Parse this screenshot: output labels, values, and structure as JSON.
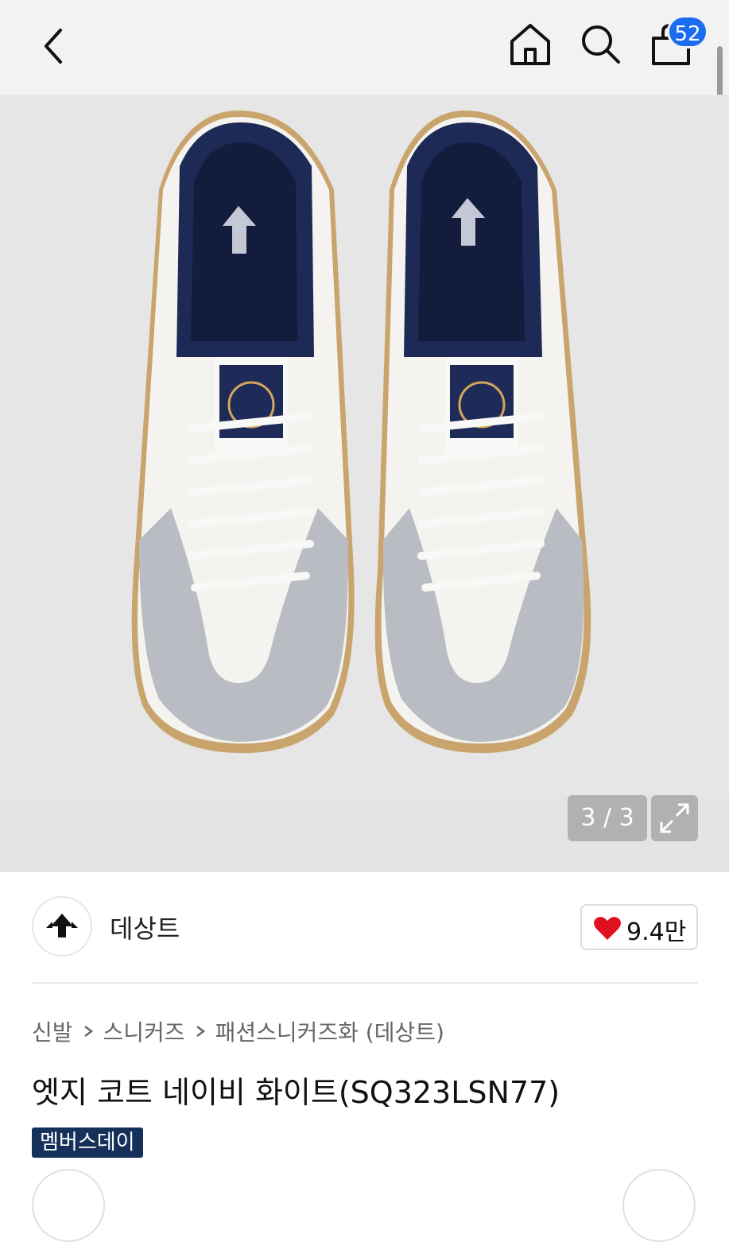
{
  "header": {
    "back_icon": "chevron-left-icon",
    "home_icon": "home-icon",
    "search_icon": "search-icon",
    "cart_icon": "shopping-bag-icon",
    "cart_count": "52",
    "badge_color": "#1a6cf0"
  },
  "gallery": {
    "counter": "3 / 3",
    "expand_icon": "expand-icon"
  },
  "brand": {
    "name": "데상트",
    "like_count": "9.4만",
    "heart_color": "#e01020"
  },
  "breadcrumb": [
    "신발",
    "스니커즈",
    "패션스니커즈화 (데상트)"
  ],
  "product": {
    "title": "엣지 코트 네이비 화이트(SQ323LSN77)",
    "tag": "멤버스데이",
    "tag_color": "#15305a"
  }
}
